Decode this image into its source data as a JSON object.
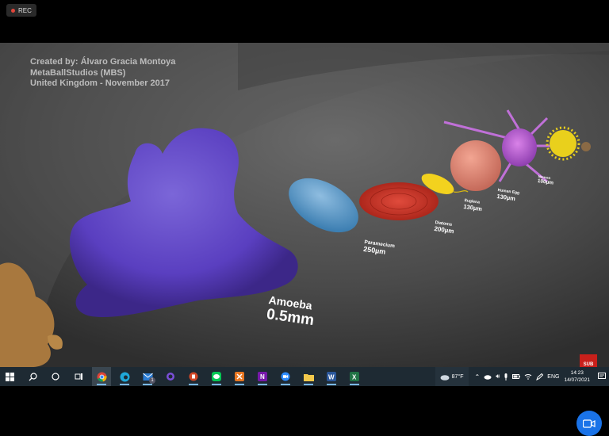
{
  "recording": {
    "label": "REC"
  },
  "video": {
    "credits": [
      "Created by: Álvaro Gracia Montoya",
      "MetaBallStudios (MBS)",
      "United Kingdom - November 2017"
    ],
    "organisms": [
      {
        "name": "Amoeba",
        "size": "0.5mm"
      },
      {
        "name": "Paramecium",
        "size": "250µm"
      },
      {
        "name": "Diatoms",
        "size": "200µm"
      },
      {
        "name": "Euglena",
        "size": "130µm"
      },
      {
        "name": "Human Egg",
        "size": "130µm"
      },
      {
        "name": "Neuron",
        "size": "100µm"
      }
    ],
    "badge": "SUB"
  },
  "taskbar": {
    "apps": [
      "windows-start",
      "search",
      "cortana",
      "task-view",
      "chrome",
      "edge",
      "mail",
      "app-purple",
      "powerpoint",
      "line",
      "app-orange",
      "onenote",
      "zoom",
      "file-explorer",
      "word",
      "excel"
    ],
    "mail_badge": "1",
    "weather": "87°F",
    "language": "ENG",
    "time": "14:23",
    "date": "14/07/2021"
  },
  "colors": {
    "accent": "#1a73e8",
    "rec": "#e0453a",
    "taskbar": "#1e2a33"
  }
}
